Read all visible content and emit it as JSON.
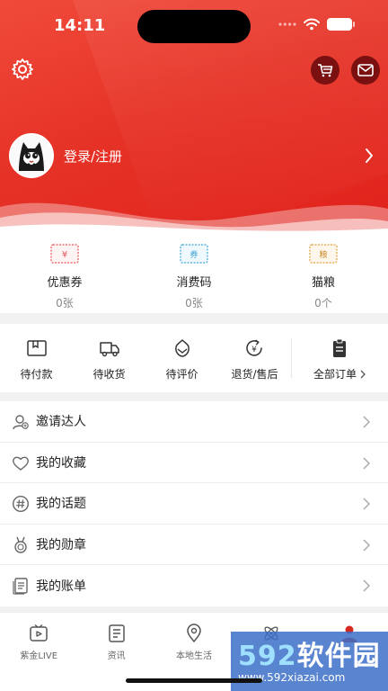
{
  "status_bar": {
    "time": "14:11"
  },
  "user": {
    "login_label": "登录/注册"
  },
  "assets": [
    {
      "ticket_glyph": "¥",
      "label": "优惠券",
      "value": "0张",
      "color": "#e8545a"
    },
    {
      "ticket_glyph": "券",
      "label": "消费码",
      "value": "0张",
      "color": "#3fa6d8"
    },
    {
      "ticket_glyph": "粮",
      "label": "猫粮",
      "value": "0个",
      "color": "#e0a03a"
    }
  ],
  "orders": {
    "items": [
      {
        "label": "待付款",
        "icon": "wallet-icon"
      },
      {
        "label": "待收货",
        "icon": "truck-icon"
      },
      {
        "label": "待评价",
        "icon": "review-icon"
      },
      {
        "label": "退货/售后",
        "icon": "refund-icon"
      }
    ],
    "all": {
      "label": "全部订单",
      "icon": "clipboard-icon"
    }
  },
  "menu": [
    {
      "label": "邀请达人",
      "icon": "invite-user-icon"
    },
    {
      "label": "我的收藏",
      "icon": "heart-icon"
    },
    {
      "label": "我的话题",
      "icon": "hashtag-icon"
    },
    {
      "label": "我的勋章",
      "icon": "medal-icon"
    },
    {
      "label": "我的账单",
      "icon": "bill-icon"
    }
  ],
  "tabbar": [
    {
      "label": "紫金LIVE",
      "icon": "live-tv-icon",
      "active": false
    },
    {
      "label": "资讯",
      "icon": "news-icon",
      "active": false
    },
    {
      "label": "本地生活",
      "icon": "location-pin-icon",
      "active": false
    },
    {
      "label": "",
      "icon": "atom-icon",
      "active": false
    },
    {
      "label": "",
      "icon": "profile-icon",
      "active": true
    }
  ],
  "watermark": {
    "brand_num": "592",
    "brand_text": "软件园",
    "url": "www.592xiazai.com"
  },
  "colors": {
    "header_red": "#e63327",
    "accent_red": "#d42a20"
  }
}
